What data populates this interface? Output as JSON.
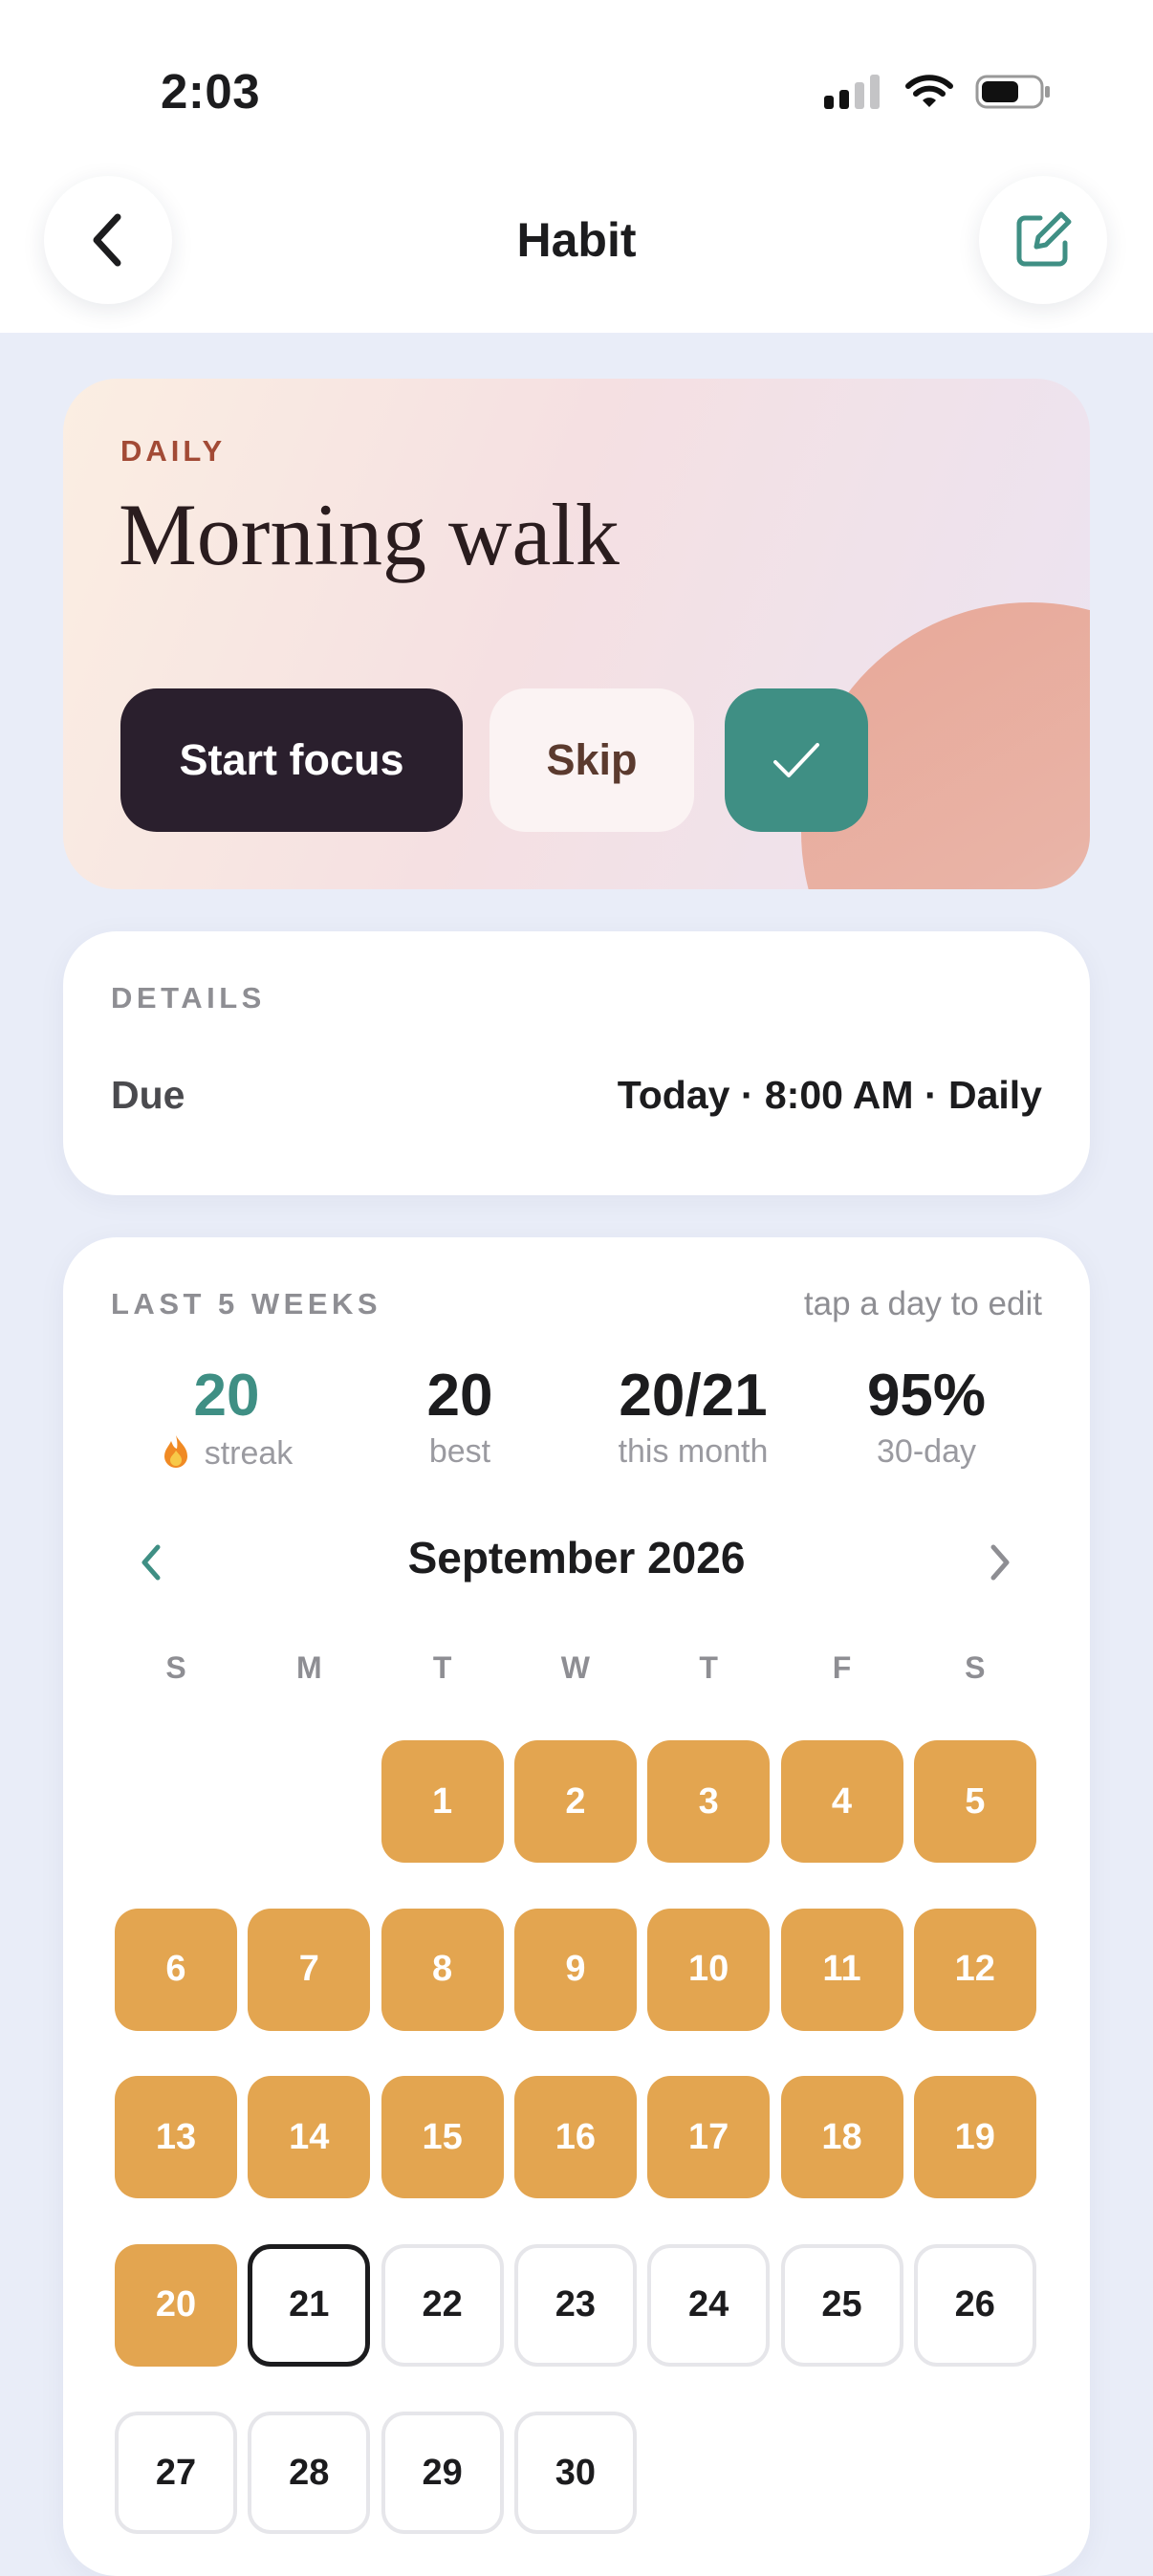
{
  "status_bar": {
    "time": "2:03"
  },
  "nav": {
    "title": "Habit"
  },
  "hero": {
    "frequency": "DAILY",
    "title": "Morning walk",
    "start_label": "Start focus",
    "skip_label": "Skip"
  },
  "details": {
    "section_label": "DETAILS",
    "due_label": "Due",
    "due_value": "Today · 8:00 AM · Daily"
  },
  "history": {
    "section_label": "LAST 5 WEEKS",
    "hint": "tap a day to edit",
    "stats": [
      {
        "value": "20",
        "label": "streak"
      },
      {
        "value": "20",
        "label": "best"
      },
      {
        "value": "20/21",
        "label": "this month"
      },
      {
        "value": "95%",
        "label": "30-day"
      }
    ],
    "month": "September 2026",
    "weekdays": [
      "S",
      "M",
      "T",
      "W",
      "T",
      "F",
      "S"
    ],
    "first_weekday_index": 2,
    "today": 21,
    "days": [
      {
        "n": "1",
        "status": "done"
      },
      {
        "n": "2",
        "status": "done"
      },
      {
        "n": "3",
        "status": "done"
      },
      {
        "n": "4",
        "status": "done"
      },
      {
        "n": "5",
        "status": "done"
      },
      {
        "n": "6",
        "status": "done"
      },
      {
        "n": "7",
        "status": "done"
      },
      {
        "n": "8",
        "status": "done"
      },
      {
        "n": "9",
        "status": "done"
      },
      {
        "n": "10",
        "status": "done"
      },
      {
        "n": "11",
        "status": "done"
      },
      {
        "n": "12",
        "status": "done"
      },
      {
        "n": "13",
        "status": "done"
      },
      {
        "n": "14",
        "status": "done"
      },
      {
        "n": "15",
        "status": "done"
      },
      {
        "n": "16",
        "status": "done"
      },
      {
        "n": "17",
        "status": "done"
      },
      {
        "n": "18",
        "status": "done"
      },
      {
        "n": "19",
        "status": "done"
      },
      {
        "n": "20",
        "status": "done"
      },
      {
        "n": "21",
        "status": "today"
      },
      {
        "n": "22",
        "status": "future"
      },
      {
        "n": "23",
        "status": "future"
      },
      {
        "n": "24",
        "status": "future"
      },
      {
        "n": "25",
        "status": "future"
      },
      {
        "n": "26",
        "status": "future"
      },
      {
        "n": "27",
        "status": "future"
      },
      {
        "n": "28",
        "status": "future"
      },
      {
        "n": "29",
        "status": "future"
      },
      {
        "n": "30",
        "status": "future"
      }
    ]
  },
  "colors": {
    "accent_teal": "#3f8f84",
    "done_orange": "#e3a550",
    "primary_dark": "#2a1f2d"
  }
}
